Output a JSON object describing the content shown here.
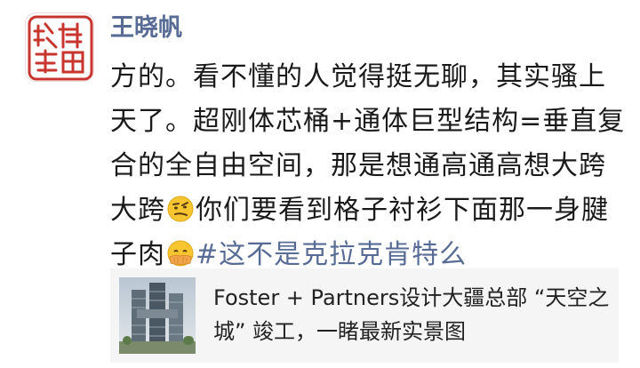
{
  "author": {
    "name": "王晓帆",
    "avatar_icon": "red-seal-stamp-icon",
    "avatar_seal_text": "谢龍循晉"
  },
  "post": {
    "lines": [
      "方的。看不懂的人觉得挺无聊，其实骚上",
      "天了。超刚体芯桶+通体巨型结构=垂直复",
      "合的全自由空间，那是想通高通高想大跨"
    ],
    "line4_before_emoji": "大跨",
    "line4_after_emoji": "你们要看到格子衬衫下面那一身腱",
    "line5_before_emoji": "子肉",
    "hashtag": "#这不是克拉克肯特么",
    "emoji1": "skeptical-smirk-emoji-icon",
    "emoji2": "facepalm-emoji-icon"
  },
  "link_card": {
    "title": "Foster + Partners设计大疆总部 “天空之城” 竣工，一睹最新实景图",
    "thumbnail": "building-towers-photo"
  },
  "colors": {
    "name_link": "#576b95",
    "text": "#1a1a1a",
    "card_bg": "#f5f5f5",
    "seal_red": "#c8342e"
  }
}
